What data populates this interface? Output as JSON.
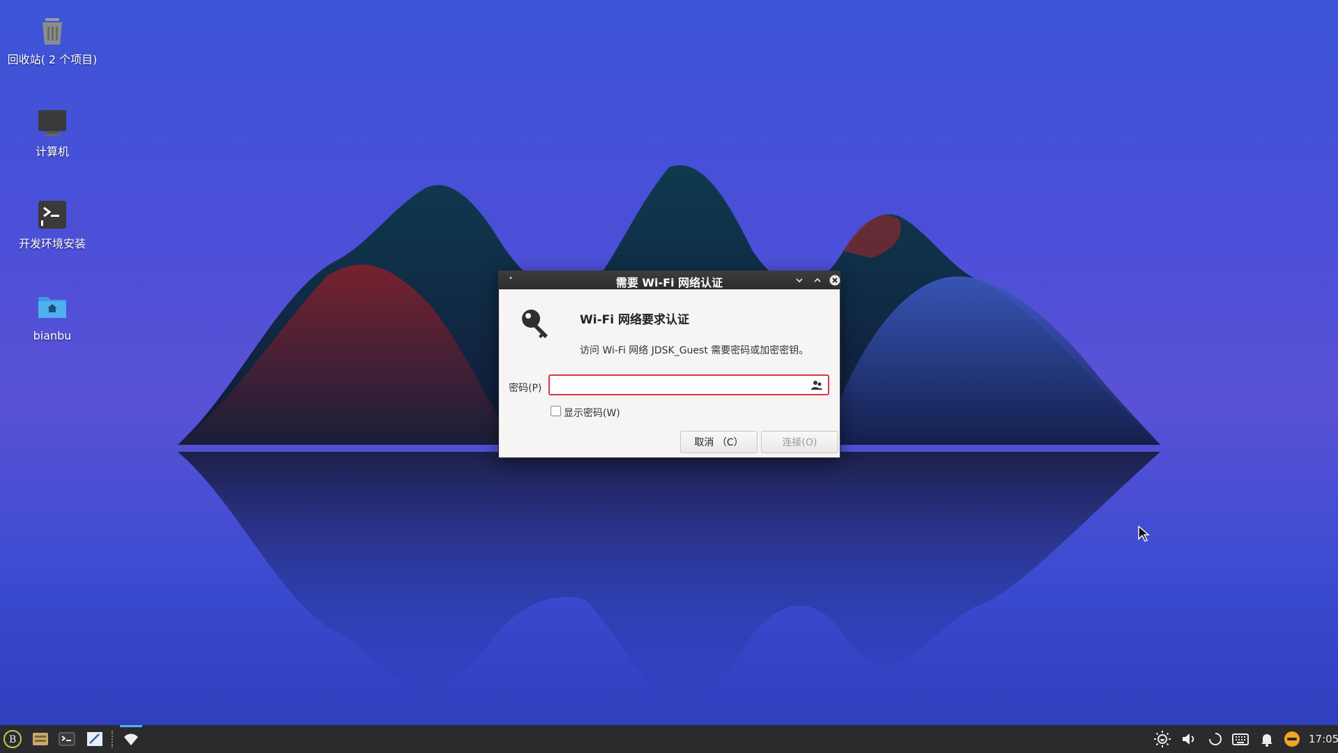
{
  "desktop": {
    "icons": [
      {
        "label": "回收站( 2 个项目)"
      },
      {
        "label": "计算机"
      },
      {
        "label": "开发环境安装"
      },
      {
        "label": "bianbu"
      }
    ]
  },
  "dialog": {
    "title": "需要 Wi-Fi 网络认证",
    "heading": "Wi-Fi 网络要求认证",
    "description": "访问 Wi-Fi 网络 JDSK_Guest 需要密码或加密密钥。",
    "password_label": "密码(P)",
    "password_value": "",
    "show_password_label": "显示密码(W)",
    "cancel_label": "取消 （C）",
    "connect_label": "连接(O)"
  },
  "taskbar": {
    "clock": "17:05",
    "accent": "#4db6e6"
  },
  "colors": {
    "input_error_border": "#d9363e",
    "dialog_bg": "#f6f5f4",
    "titlebar_bg": "#2c2c2e"
  }
}
